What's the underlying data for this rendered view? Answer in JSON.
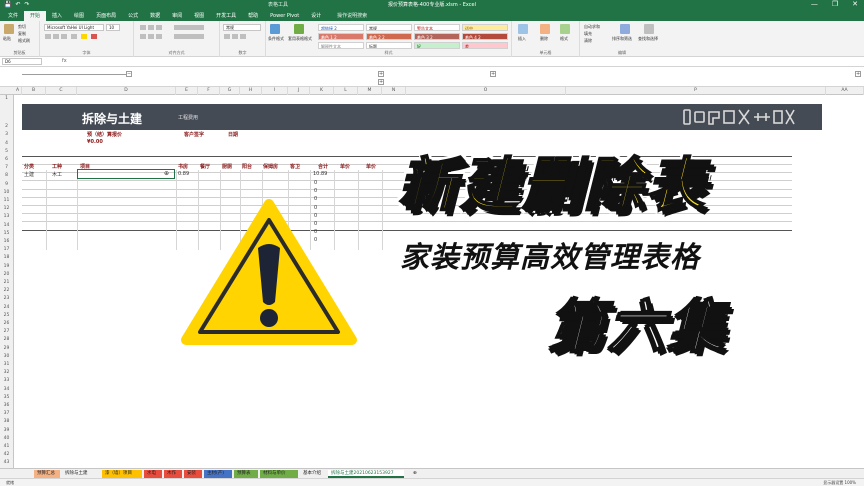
{
  "titlebar": {
    "doc_title": "报价预算表格-400专业版.xlsm - Excel",
    "tools_label": "表格工具",
    "qat": [
      "💾",
      "↶",
      "↷"
    ],
    "window_controls": [
      "—",
      "❐",
      "✕"
    ]
  },
  "tabs": {
    "items": [
      "文件",
      "开始",
      "插入",
      "绘图",
      "页面布局",
      "公式",
      "数据",
      "审阅",
      "视图",
      "开发工具",
      "帮助",
      "Power Pivot",
      "设计"
    ],
    "active_index": 1,
    "search_placeholder": "操作说明搜索"
  },
  "ribbon": {
    "clipboard": {
      "paste": "粘贴",
      "cut": "剪切",
      "copy": "复制",
      "format_painter": "格式刷",
      "label": "剪贴板"
    },
    "font": {
      "font_name": "Microsoft YaHei UI Light",
      "font_size": "10",
      "label": "字体"
    },
    "alignment": {
      "label": "对齐方式"
    },
    "number": {
      "format": "常规",
      "label": "数字"
    },
    "styles_left": {
      "conditional": "条件格式",
      "table": "套用表格格式"
    },
    "styles": {
      "cells": [
        {
          "text": "超链接 2",
          "bg": "#ffffff",
          "fg": "#1155cc"
        },
        {
          "text": "常规",
          "bg": "#ffffff",
          "fg": "#222222"
        },
        {
          "text": "警告文本",
          "bg": "#ffffff",
          "fg": "#c00000"
        },
        {
          "text": "适中",
          "bg": "#ffeb9c",
          "fg": "#9c5700"
        },
        {
          "text": "着色 1 2",
          "bg": "#d9796c",
          "fg": "#ffffff"
        },
        {
          "text": "着色 2 2",
          "bg": "#cf6a4f",
          "fg": "#ffffff"
        },
        {
          "text": "着色 3 2",
          "bg": "#b3655b",
          "fg": "#ffffff"
        },
        {
          "text": "着色 4 2",
          "bg": "#b34a3c",
          "fg": "#ffffff"
        },
        {
          "text": "解释性文本",
          "bg": "#ffffff",
          "fg": "#7f7f7f"
        },
        {
          "text": "标题",
          "bg": "#ffffff",
          "fg": "#333333"
        },
        {
          "text": "好",
          "bg": "#c6efce",
          "fg": "#006100"
        },
        {
          "text": "差",
          "bg": "#ffc7ce",
          "fg": "#9c0006"
        }
      ],
      "label": "样式"
    },
    "cells_group": {
      "insert": "插入",
      "delete": "删除",
      "format": "格式",
      "label": "单元格"
    },
    "editing": {
      "autosum": "自动求和",
      "fill": "填充",
      "clear": "清除",
      "sort": "排序和筛选",
      "find": "查找和选择",
      "label": "编辑"
    }
  },
  "formula_bar": {
    "name_box": "D6",
    "fx": "fx",
    "formula": ""
  },
  "columns": [
    "A",
    "B",
    "C",
    "D",
    "E",
    "F",
    "G",
    "H",
    "I",
    "J",
    "K",
    "L",
    "M",
    "N",
    "O",
    "P",
    "AA"
  ],
  "rows": [
    "1",
    "2",
    "3",
    "4",
    "5",
    "6",
    "7",
    "8",
    "9",
    "10",
    "11",
    "12",
    "13",
    "14",
    "15",
    "16",
    "17",
    "18",
    "19",
    "20",
    "21",
    "22",
    "23",
    "24",
    "25",
    "26",
    "27",
    "28",
    "29",
    "30",
    "31",
    "32",
    "33",
    "34",
    "35",
    "36",
    "37",
    "38",
    "39",
    "40",
    "41",
    "42",
    "43",
    "44",
    "45"
  ],
  "sheet": {
    "banner_title": "拆除与土建",
    "banner_sub": "工程费用",
    "budget_label": "预（结）算报价",
    "budget_value": "¥0.00",
    "customer_label": "客户签字",
    "date_label": "日期",
    "table_headers": [
      "分类",
      "工种",
      "项目",
      "书房",
      "餐厅",
      "厨厕",
      "阳台",
      "保姆房",
      "客卫",
      "合计",
      "单价",
      "单价"
    ],
    "row6": {
      "category": "土建",
      "trade": "木工",
      "first_value": "0.89",
      "total": "10.89"
    },
    "zero": "0"
  },
  "overlay": {
    "headline": "新建删除表",
    "subline": "家装预算高效管理表格",
    "episode": "第六集"
  },
  "sheet_tabs": [
    {
      "label": "预算汇总",
      "bg": "#f4b183",
      "active": false
    },
    {
      "label": "拆除与土建",
      "bg": "#f0f0f0",
      "active": false
    },
    {
      "label": "漆（墙）项目",
      "bg": "#ffc000",
      "active": false
    },
    {
      "label": "水电",
      "bg": "#e84c3d",
      "active": false
    },
    {
      "label": "木作",
      "bg": "#e84c3d",
      "active": false
    },
    {
      "label": "安装",
      "bg": "#e84c3d",
      "active": false
    },
    {
      "label": "主材(产)",
      "bg": "#4472c4",
      "active": false
    },
    {
      "label": "预算表",
      "bg": "#70ad47",
      "active": false
    },
    {
      "label": "材料与单价",
      "bg": "#70ad47",
      "active": false
    },
    {
      "label": "基本介绍",
      "bg": "#f0f0f0",
      "active": false
    },
    {
      "label": "拆除与土建20210623153927",
      "bg": "#ffffff",
      "active": true
    }
  ],
  "status": {
    "ready": "就绪",
    "zoom": "显示器设置  100%"
  }
}
